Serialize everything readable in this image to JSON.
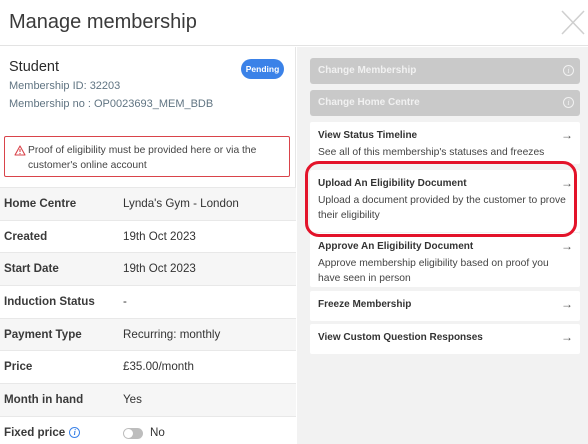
{
  "modal": {
    "title": "Manage membership"
  },
  "member": {
    "name": "Student",
    "membership_id": "Membership ID: 32203",
    "membership_no": "Membership no : OP0023693_MEM_BDB",
    "status_badge": "Pending"
  },
  "alert": {
    "text": "Proof of eligibility must be provided here or via the customer's online account"
  },
  "details": [
    {
      "label": "Home Centre",
      "value": "Lynda's Gym - London"
    },
    {
      "label": "Created",
      "value": "19th Oct 2023"
    },
    {
      "label": "Start Date",
      "value": "19th Oct 2023"
    },
    {
      "label": "Induction Status",
      "value": "-"
    },
    {
      "label": "Payment Type",
      "value": "Recurring: monthly"
    },
    {
      "label": "Price",
      "value": "£35.00/month"
    },
    {
      "label": "Month in hand",
      "value": "Yes"
    },
    {
      "label": "Fixed price",
      "value": "No",
      "toggle_on": false
    }
  ],
  "actions": [
    {
      "title": "Change Membership",
      "disabled": true
    },
    {
      "title": "Change Home Centre",
      "disabled": true
    },
    {
      "title": "View Status Timeline",
      "description": "See all of this membership's statuses and freezes"
    },
    {
      "title": "Upload An Eligibility Document",
      "description": "Upload a document provided by the customer to prove their eligibility",
      "highlighted": true
    },
    {
      "title": "Approve An Eligibility Document",
      "description": "Approve membership eligibility based on proof you have seen in person"
    },
    {
      "title": "Freeze Membership",
      "description": ""
    },
    {
      "title": "View Custom Question Responses",
      "description": ""
    }
  ],
  "colors": {
    "accent": "#3b82e8",
    "alert_border": "#d9434a",
    "highlight": "#e3132a",
    "disabled_action": "#c9c9c9"
  }
}
